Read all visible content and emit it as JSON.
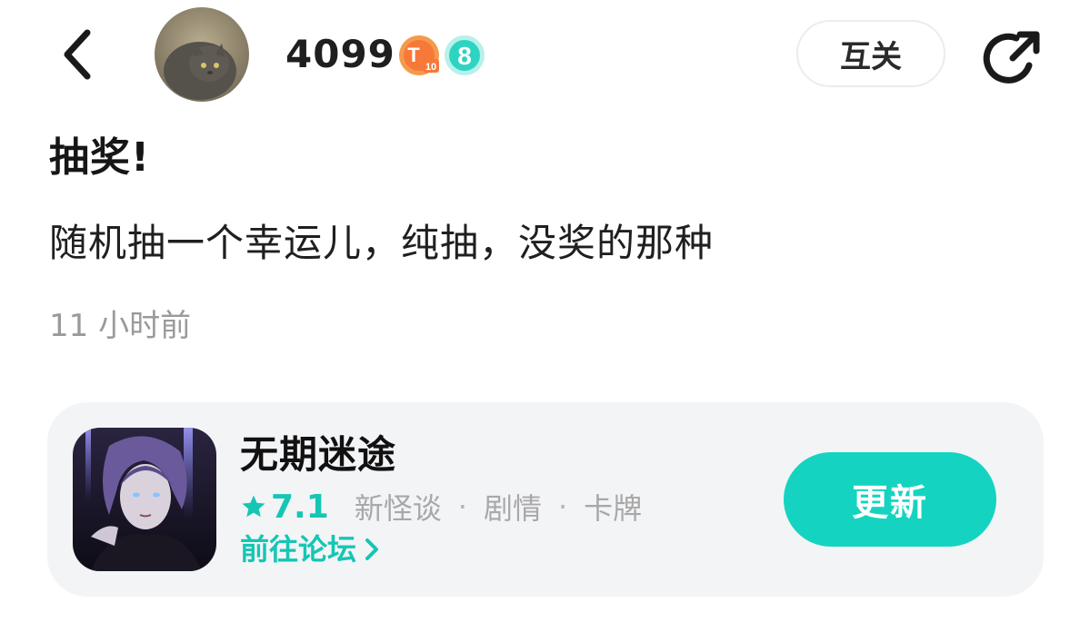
{
  "header": {
    "username": "4099",
    "badge_t_label": "T",
    "badge_t_level": "10",
    "level": "8",
    "mutual_label": "互关"
  },
  "post": {
    "title": "抽奖!",
    "body": "随机抽一个幸运儿，纯抽，没奖的那种",
    "time": "11 小时前"
  },
  "game_card": {
    "name": "无期迷途",
    "rating": "7.1",
    "tags": [
      "新怪谈",
      "剧情",
      "卡牌"
    ],
    "separator": "·",
    "forum_label": "前往论坛",
    "action_label": "更新"
  },
  "colors": {
    "accent": "#14d4c1",
    "accent_text": "#15c6b4",
    "card_bg": "#f3f4f6",
    "muted_text": "#9a9a9a"
  },
  "icons": {
    "back": "chevron-left-icon",
    "share": "share-icon",
    "rating": "star-icon",
    "forum_arrow": "chevron-right-icon"
  }
}
